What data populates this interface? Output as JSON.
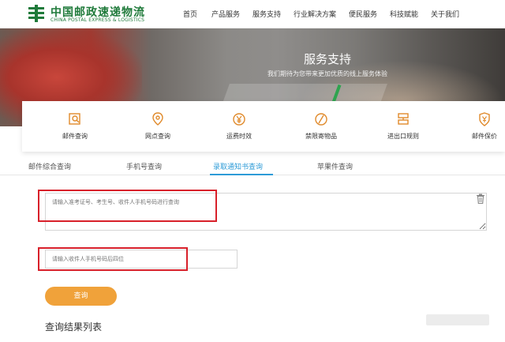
{
  "header": {
    "logo_cn": "中国邮政速递物流",
    "logo_en": "CHINA POSTAL EXPRESS & LOGISTICS",
    "nav": [
      "首页",
      "产品服务",
      "服务支持",
      "行业解决方案",
      "便民服务",
      "科技赋能",
      "关于我们"
    ]
  },
  "banner": {
    "title": "服务支持",
    "subtitle": "我们期待为您带来更加优质的线上服务体验"
  },
  "services": [
    {
      "label": "邮件查询",
      "icon": "mail-search-icon"
    },
    {
      "label": "网点查询",
      "icon": "location-pin-icon"
    },
    {
      "label": "运费时效",
      "icon": "yen-coin-icon"
    },
    {
      "label": "禁限寄物品",
      "icon": "prohibited-icon"
    },
    {
      "label": "进出口规则",
      "icon": "customs-icon"
    },
    {
      "label": "邮件保价",
      "icon": "shield-yen-icon"
    }
  ],
  "tabs": [
    "邮件综合查询",
    "手机号查询",
    "录取通知书查询",
    "苹果件查询"
  ],
  "active_tab": 2,
  "form": {
    "textarea_placeholder": "请输入准考证号、考生号、收件人手机号码进行查询",
    "input_placeholder": "请输入收件人手机号码后四位",
    "submit_label": "查询"
  },
  "results_title": "查询结果列表",
  "colors": {
    "brand_green": "#1f7a3a",
    "accent_blue": "#2d9bd7",
    "button_orange": "#f0a23a",
    "highlight_red": "#d8202a",
    "icon_orange": "#e08a2b"
  }
}
